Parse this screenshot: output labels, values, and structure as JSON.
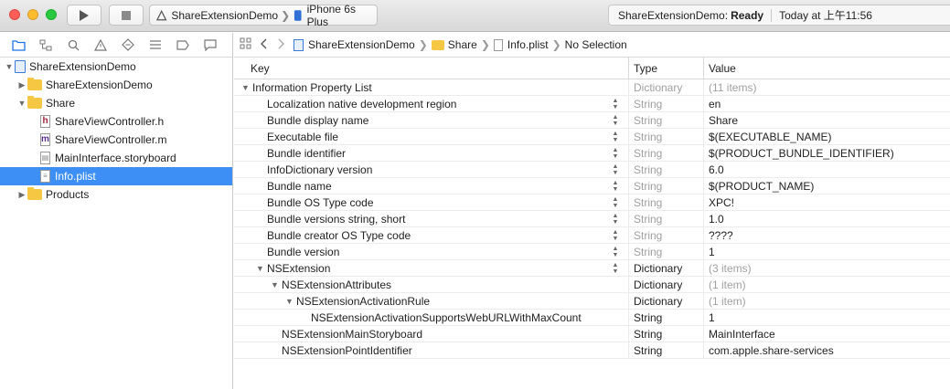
{
  "toolbar": {
    "scheme": "ShareExtensionDemo",
    "device": "iPhone 6s Plus",
    "status_project": "ShareExtensionDemo:",
    "status_state": "Ready",
    "status_time": "Today at 上午11:56"
  },
  "navigator": {
    "items": [
      {
        "label": "ShareExtensionDemo",
        "type": "project",
        "indent": 0,
        "disclosure": "open"
      },
      {
        "label": "ShareExtensionDemo",
        "type": "folder",
        "indent": 1,
        "disclosure": "closed"
      },
      {
        "label": "Share",
        "type": "folder",
        "indent": 1,
        "disclosure": "open"
      },
      {
        "label": "ShareViewController.h",
        "type": "h",
        "indent": 2,
        "disclosure": ""
      },
      {
        "label": "ShareViewController.m",
        "type": "m",
        "indent": 2,
        "disclosure": ""
      },
      {
        "label": "MainInterface.storyboard",
        "type": "storyboard",
        "indent": 2,
        "disclosure": ""
      },
      {
        "label": "Info.plist",
        "type": "plist",
        "indent": 2,
        "disclosure": "",
        "selected": true
      },
      {
        "label": "Products",
        "type": "folder",
        "indent": 1,
        "disclosure": "closed"
      }
    ]
  },
  "jumpbar": {
    "project": "ShareExtensionDemo",
    "group": "Share",
    "file": "Info.plist",
    "selection": "No Selection"
  },
  "plist": {
    "headers": {
      "key": "Key",
      "type": "Type",
      "value": "Value"
    },
    "rows": [
      {
        "key": "Information Property List",
        "type": "Dictionary",
        "value": "(11 items)",
        "indent": 0,
        "disclosure": "open",
        "gray": true,
        "stepper": false
      },
      {
        "key": "Localization native development region",
        "type": "String",
        "value": "en",
        "indent": 1,
        "disclosure": "",
        "gray": true,
        "stepper": true
      },
      {
        "key": "Bundle display name",
        "type": "String",
        "value": "Share",
        "indent": 1,
        "disclosure": "",
        "gray": true,
        "stepper": true
      },
      {
        "key": "Executable file",
        "type": "String",
        "value": "$(EXECUTABLE_NAME)",
        "indent": 1,
        "disclosure": "",
        "gray": true,
        "stepper": true
      },
      {
        "key": "Bundle identifier",
        "type": "String",
        "value": "$(PRODUCT_BUNDLE_IDENTIFIER)",
        "indent": 1,
        "disclosure": "",
        "gray": true,
        "stepper": true
      },
      {
        "key": "InfoDictionary version",
        "type": "String",
        "value": "6.0",
        "indent": 1,
        "disclosure": "",
        "gray": true,
        "stepper": true
      },
      {
        "key": "Bundle name",
        "type": "String",
        "value": "$(PRODUCT_NAME)",
        "indent": 1,
        "disclosure": "",
        "gray": true,
        "stepper": true
      },
      {
        "key": "Bundle OS Type code",
        "type": "String",
        "value": "XPC!",
        "indent": 1,
        "disclosure": "",
        "gray": true,
        "stepper": true
      },
      {
        "key": "Bundle versions string, short",
        "type": "String",
        "value": "1.0",
        "indent": 1,
        "disclosure": "",
        "gray": true,
        "stepper": true
      },
      {
        "key": "Bundle creator OS Type code",
        "type": "String",
        "value": "????",
        "indent": 1,
        "disclosure": "",
        "gray": true,
        "stepper": true
      },
      {
        "key": "Bundle version",
        "type": "String",
        "value": "1",
        "indent": 1,
        "disclosure": "",
        "gray": true,
        "stepper": true
      },
      {
        "key": "NSExtension",
        "type": "Dictionary",
        "value": "(3 items)",
        "indent": 1,
        "disclosure": "open",
        "gray": false,
        "valgray": true,
        "stepper": true
      },
      {
        "key": "NSExtensionAttributes",
        "type": "Dictionary",
        "value": "(1 item)",
        "indent": 2,
        "disclosure": "open",
        "gray": false,
        "valgray": true,
        "stepper": false
      },
      {
        "key": "NSExtensionActivationRule",
        "type": "Dictionary",
        "value": "(1 item)",
        "indent": 3,
        "disclosure": "open",
        "gray": false,
        "valgray": true,
        "stepper": false
      },
      {
        "key": "NSExtensionActivationSupportsWebURLWithMaxCount",
        "type": "String",
        "value": "1",
        "indent": 4,
        "disclosure": "",
        "gray": false,
        "stepper": false
      },
      {
        "key": "NSExtensionMainStoryboard",
        "type": "String",
        "value": "MainInterface",
        "indent": 2,
        "disclosure": "",
        "gray": false,
        "stepper": false
      },
      {
        "key": "NSExtensionPointIdentifier",
        "type": "String",
        "value": "com.apple.share-services",
        "indent": 2,
        "disclosure": "",
        "gray": false,
        "stepper": false
      }
    ]
  }
}
